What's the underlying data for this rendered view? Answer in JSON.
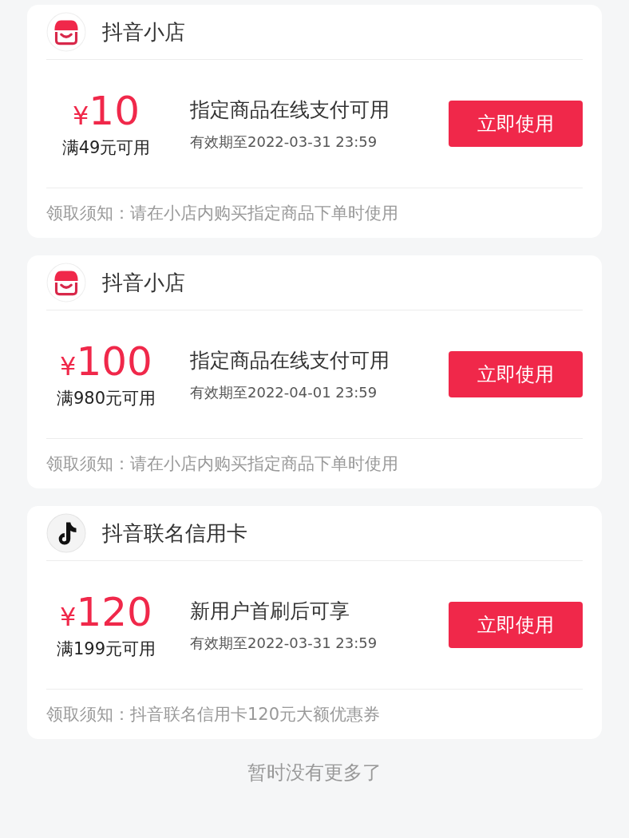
{
  "coupons": [
    {
      "shop": {
        "name": "抖音小店",
        "kind": "shop"
      },
      "amount_symbol": "¥",
      "amount": "10",
      "threshold": "满49元可用",
      "title": "指定商品在线支付可用",
      "validity": "有效期至2022-03-31 23:59",
      "button": "立即使用",
      "note_label": "领取须知：",
      "note": "请在小店内购买指定商品下单时使用"
    },
    {
      "shop": {
        "name": "抖音小店",
        "kind": "shop"
      },
      "amount_symbol": "¥",
      "amount": "100",
      "threshold": "满980元可用",
      "title": "指定商品在线支付可用",
      "validity": "有效期至2022-04-01 23:59",
      "button": "立即使用",
      "note_label": "领取须知：",
      "note": "请在小店内购买指定商品下单时使用"
    },
    {
      "shop": {
        "name": "抖音联名信用卡",
        "kind": "card"
      },
      "amount_symbol": "¥",
      "amount": "120",
      "threshold": "满199元可用",
      "title": "新用户首刷后可享",
      "validity": "有效期至2022-03-31 23:59",
      "button": "立即使用",
      "note_label": "领取须知：",
      "note": "抖音联名信用卡120元大额优惠券"
    }
  ],
  "footer": "暂时没有更多了"
}
